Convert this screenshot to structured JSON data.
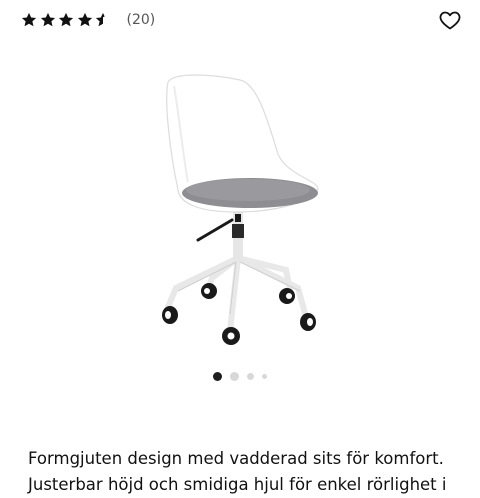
{
  "rating": {
    "value": 4.5,
    "max": 5,
    "count_label": "(20)"
  },
  "icons": {
    "favorite": "heart-outline-icon",
    "star_full": "star-filled-icon",
    "star_half": "star-half-icon"
  },
  "colors": {
    "star": "#111111",
    "dot_active": "#1e1e1e",
    "dot_inactive": "#d8d8d8",
    "seat_cushion": "#8e8e92"
  },
  "gallery": {
    "image_alt": "Kontorsstol, vit med grå sits",
    "active_index": 0,
    "total": 4
  },
  "description": {
    "line1": "Formgjuten design med vadderad sits för komfort.",
    "line2": "Justerbar höjd och smidiga hjul för enkel rörlighet i"
  }
}
